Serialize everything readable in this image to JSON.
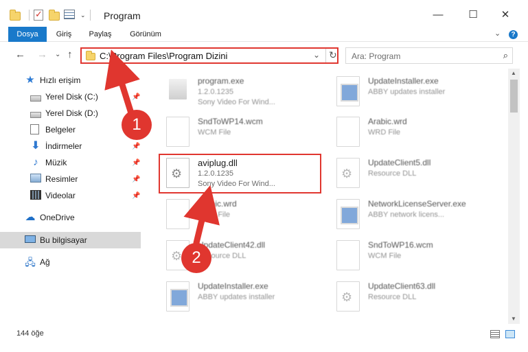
{
  "window": {
    "title": "Program",
    "minimize_glyph": "—",
    "maximize_glyph": "☐",
    "close_glyph": "✕"
  },
  "ribbon": {
    "tabs": [
      {
        "label": "Dosya",
        "active": true
      },
      {
        "label": "Giriş",
        "active": false
      },
      {
        "label": "Paylaş",
        "active": false
      },
      {
        "label": "Görünüm",
        "active": false
      }
    ],
    "expand_glyph": "⌄",
    "help_glyph": "?"
  },
  "address": {
    "back_glyph": "←",
    "forward_glyph": "→",
    "recent_glyph": "⌄",
    "up_glyph": "↑",
    "path": "C:\\Program Files\\Program Dizini",
    "dropdown_glyph": "⌄",
    "refresh_glyph": "↻",
    "search_placeholder": "Ara: Program",
    "search_glyph": "⌕"
  },
  "sidebar": {
    "items": [
      {
        "label": "Hızlı erişim",
        "icon": "star-icon"
      },
      {
        "label": "Yerel Disk (C:)",
        "icon": "disk-icon",
        "pinned": true
      },
      {
        "label": "Yerel Disk (D:)",
        "icon": "disk-icon"
      },
      {
        "label": "Belgeler",
        "icon": "documents-icon"
      },
      {
        "label": "İndirmeler",
        "icon": "downloads-icon",
        "pinned": true
      },
      {
        "label": "Müzik",
        "icon": "music-icon",
        "pinned": true
      },
      {
        "label": "Resimler",
        "icon": "pictures-icon",
        "pinned": true
      },
      {
        "label": "Videolar",
        "icon": "videos-icon",
        "pinned": true
      },
      {
        "label": "OneDrive",
        "icon": "cloud-icon"
      },
      {
        "label": "Bu bilgisayar",
        "icon": "computer-icon",
        "selected": true
      },
      {
        "label": "Ağ",
        "icon": "network-icon"
      }
    ],
    "pin_glyph": "📌"
  },
  "files": [
    {
      "name": "program.exe",
      "line2": "1.2.0.1235",
      "line3": "Sony Video For Wind...",
      "icon": "exe"
    },
    {
      "name": "UpdateInstaller.exe",
      "line2": "ABBY updates installer",
      "line3": "",
      "icon": "blue"
    },
    {
      "name": "SndToWP14.wcm",
      "line2": "WCM File",
      "line3": "",
      "icon": "doc"
    },
    {
      "name": "Arabic.wrd",
      "line2": "WRD File",
      "line3": "",
      "icon": "doc"
    },
    {
      "name": "aviplug.dll",
      "line2": "1.2.0.1235",
      "line3": "Sony Video For Wind...",
      "icon": "gear"
    },
    {
      "name": "UpdateClient5.dll",
      "line2": "Resource DLL",
      "line3": "",
      "icon": "gear"
    },
    {
      "name": "Arabic.wrd",
      "line2": "WRD File",
      "line3": "",
      "icon": "doc"
    },
    {
      "name": "NetworkLicenseServer.exe",
      "line2": "ABBY network licens...",
      "line3": "",
      "icon": "blue"
    },
    {
      "name": "UpdateClient42.dll",
      "line2": "Resource DLL",
      "line3": "",
      "icon": "gear"
    },
    {
      "name": "SndToWP16.wcm",
      "line2": "WCM File",
      "line3": "",
      "icon": "doc"
    },
    {
      "name": "UpdateInstaller.exe",
      "line2": "ABBY updates installer",
      "line3": "",
      "icon": "blue"
    },
    {
      "name": "UpdateClient63.dll",
      "line2": "Resource DLL",
      "line3": "",
      "icon": "gear"
    }
  ],
  "status": {
    "item_count": "144 öğe"
  },
  "callouts": [
    {
      "label": "1"
    },
    {
      "label": "2"
    }
  ],
  "colors": {
    "accent": "#1979ca",
    "highlight_red": "#e0362f",
    "selected_bg": "#d9d9d9"
  }
}
